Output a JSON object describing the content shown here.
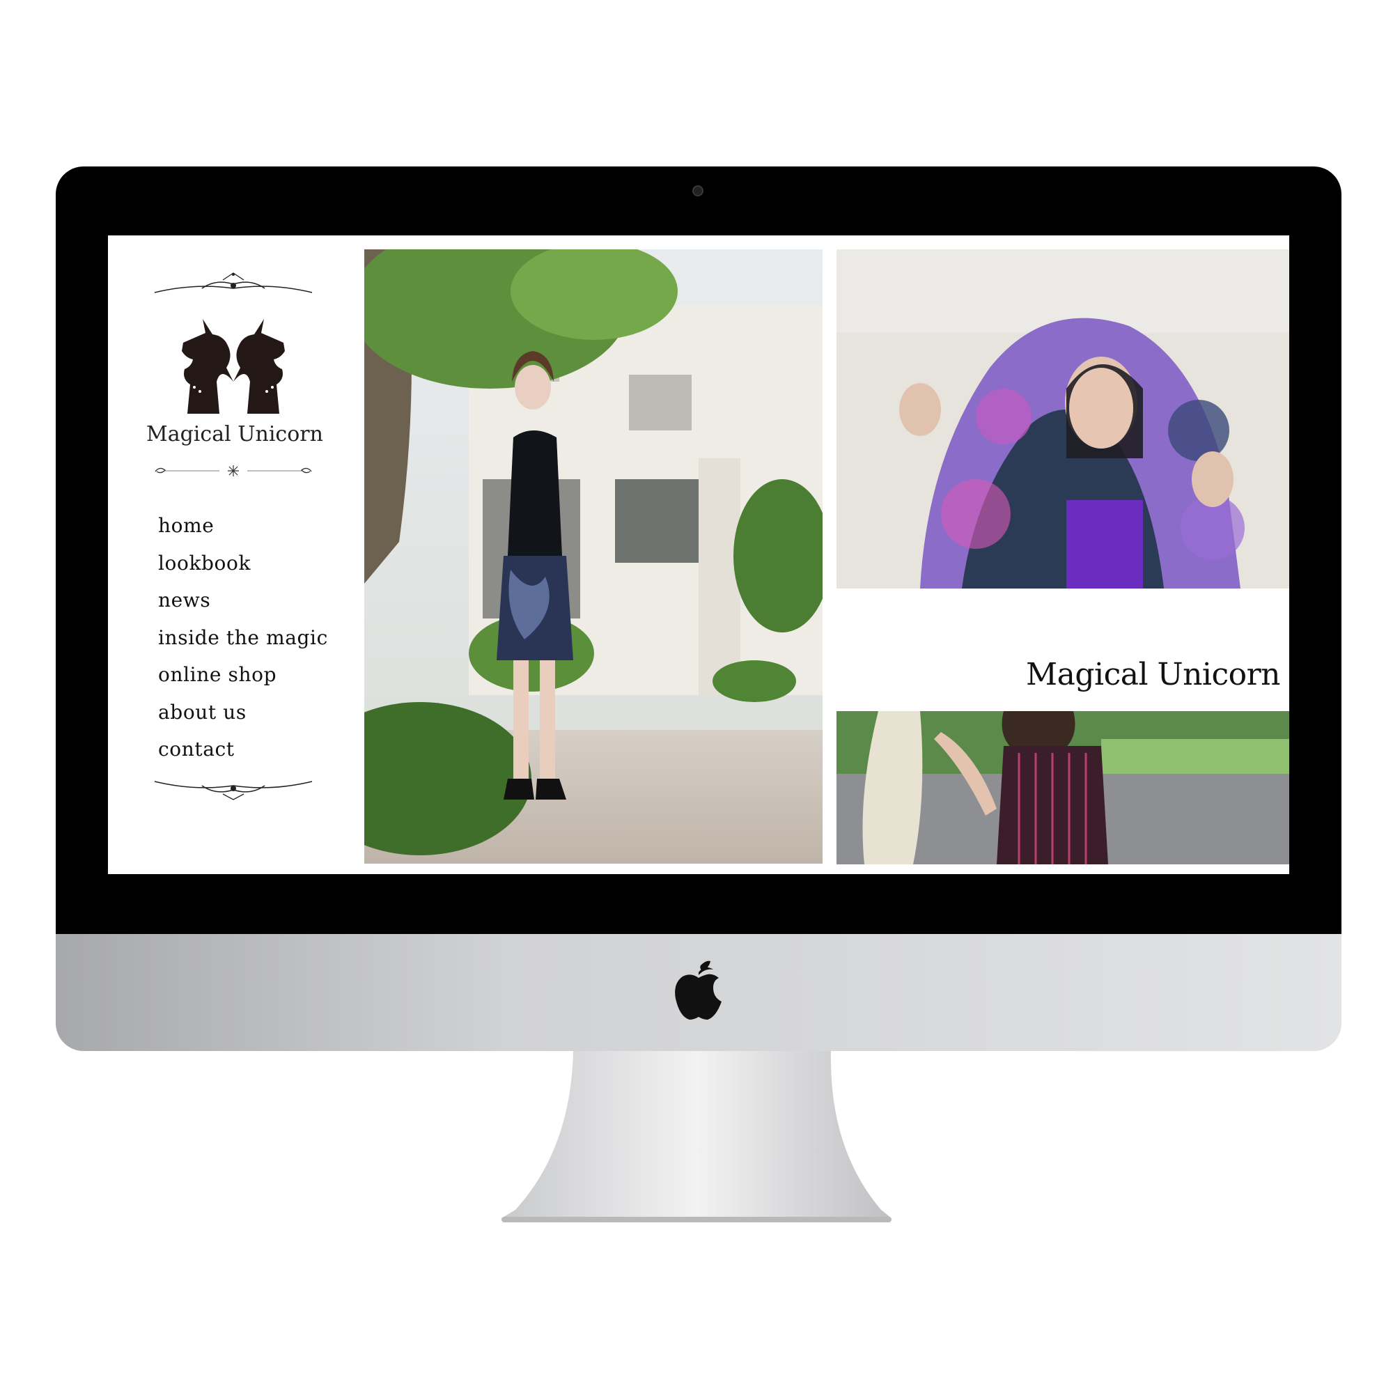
{
  "site": {
    "brand_name": "Magical Unicorn",
    "hero_title": "Magical Unicorn"
  },
  "nav": {
    "items": [
      {
        "label": "home"
      },
      {
        "label": "lookbook"
      },
      {
        "label": "news"
      },
      {
        "label": "inside the magic"
      },
      {
        "label": "online shop"
      },
      {
        "label": "about us"
      },
      {
        "label": "contact"
      }
    ]
  },
  "colors": {
    "bezel": "#000000",
    "text": "#111111",
    "aluminum": "#cfd0d2"
  },
  "icons": {
    "logo": "twin-unicorn-heart-logo",
    "device": "apple-logo-icon"
  }
}
